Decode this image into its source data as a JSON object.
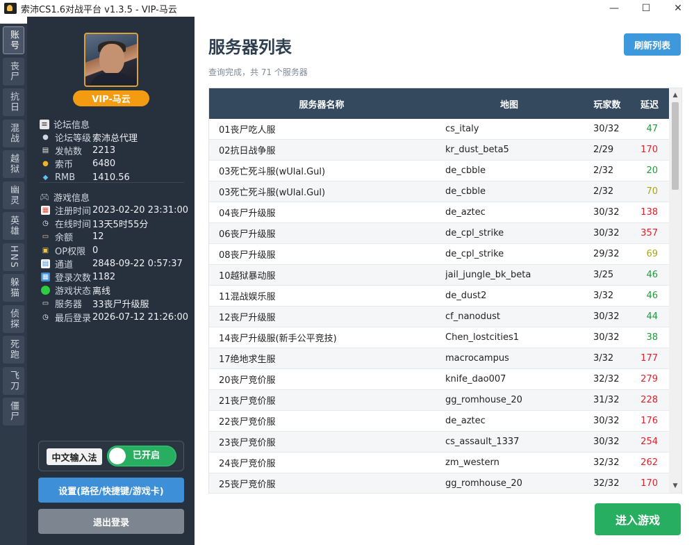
{
  "window": {
    "title": "索沛CS1.6对战平台 v1.3.5 - VIP-马云",
    "minimize": "—",
    "maximize": "☐",
    "close": "✕"
  },
  "rail": {
    "items": [
      {
        "label": "账号",
        "active": true
      },
      {
        "label": "丧尸",
        "active": false
      },
      {
        "label": "抗日",
        "active": false
      },
      {
        "label": "混战",
        "active": false
      },
      {
        "label": "越狱",
        "active": false
      },
      {
        "label": "幽灵",
        "active": false
      },
      {
        "label": "英雄",
        "active": false
      },
      {
        "label": "HNS",
        "active": false
      },
      {
        "label": "躲猫",
        "active": false
      },
      {
        "label": "侦探",
        "active": false
      },
      {
        "label": "死跑",
        "active": false
      },
      {
        "label": "飞刀",
        "active": false
      },
      {
        "label": "僵尸",
        "active": false
      }
    ]
  },
  "profile": {
    "vip_name": "VIP-马云",
    "forum_section": "论坛信息",
    "forum": [
      {
        "label": "论坛等级",
        "value": "索沛总代理",
        "icon": "user-icon"
      },
      {
        "label": "发帖数",
        "value": "2213",
        "icon": "document-icon"
      },
      {
        "label": "索币",
        "value": "6480",
        "icon": "coin-icon"
      },
      {
        "label": "RMB",
        "value": "1410.56",
        "icon": "diamond-icon"
      }
    ],
    "game_section": "游戏信息",
    "game": [
      {
        "label": "注册时间",
        "value": "2023-02-20 23:31:00",
        "icon": "calendar-icon"
      },
      {
        "label": "在线时间",
        "value": "13天5时55分",
        "icon": "stopwatch-icon"
      },
      {
        "label": "余额",
        "value": "12",
        "icon": "money-icon"
      },
      {
        "label": "OP权限",
        "value": "0",
        "icon": "lock-icon"
      },
      {
        "label": "通道",
        "value": "2848-09-22 0:57:37",
        "icon": "channel-icon"
      },
      {
        "label": "登录次数",
        "value": "1182",
        "icon": "login-icon"
      },
      {
        "label": "游戏状态",
        "value": "离线",
        "icon": "status-dot-icon"
      },
      {
        "label": "服务器",
        "value": "33丧尸升级服",
        "icon": "monitor-icon"
      },
      {
        "label": "最后登录",
        "value": "2026-07-12 21:26:00",
        "icon": "clock-icon"
      }
    ],
    "ime_label": "中文输入法",
    "ime_toggle": "已开启",
    "settings_button": "设置(路径/快捷键/游戏卡)",
    "logout_button": "退出登录"
  },
  "main": {
    "title": "服务器列表",
    "refresh_button": "刷新列表",
    "status": "查询完成，共 71 个服务器",
    "columns": [
      "服务器名称",
      "地图",
      "玩家数",
      "延迟"
    ],
    "rows": [
      {
        "name": "01丧尸吃人服",
        "map": "cs_italy",
        "players": "30/32",
        "ping": "47",
        "ping_level": "good"
      },
      {
        "name": "02抗日战争服",
        "map": "kr_dust_beta5",
        "players": "2/29",
        "ping": "170",
        "ping_level": "bad"
      },
      {
        "name": "03死亡死斗服(wUlal.Gul)",
        "map": "de_cbble",
        "players": "2/32",
        "ping": "20",
        "ping_level": "good"
      },
      {
        "name": "03死亡死斗服(wUlal.Gul)",
        "map": "de_cbble",
        "players": "2/32",
        "ping": "70",
        "ping_level": "mid"
      },
      {
        "name": "04丧尸升级服",
        "map": "de_aztec",
        "players": "30/32",
        "ping": "138",
        "ping_level": "bad"
      },
      {
        "name": "06丧尸升级服",
        "map": "de_cpl_strike",
        "players": "30/32",
        "ping": "357",
        "ping_level": "bad"
      },
      {
        "name": "08丧尸升级服",
        "map": "de_cpl_strike",
        "players": "29/32",
        "ping": "69",
        "ping_level": "mid"
      },
      {
        "name": "10越狱暴动服",
        "map": "jail_jungle_bk_beta",
        "players": "3/25",
        "ping": "46",
        "ping_level": "good"
      },
      {
        "name": "11混战娱乐服",
        "map": "de_dust2",
        "players": "3/32",
        "ping": "46",
        "ping_level": "good"
      },
      {
        "name": "12丧尸升级服",
        "map": "cf_nanodust",
        "players": "30/32",
        "ping": "44",
        "ping_level": "good"
      },
      {
        "name": "14丧尸升级服(新手公平竞技)",
        "map": "Chen_lostcities1",
        "players": "30/32",
        "ping": "38",
        "ping_level": "good"
      },
      {
        "name": "17绝地求生服",
        "map": "macrocampus",
        "players": "3/32",
        "ping": "177",
        "ping_level": "bad"
      },
      {
        "name": "20丧尸竞价服",
        "map": "knife_dao007",
        "players": "32/32",
        "ping": "279",
        "ping_level": "bad"
      },
      {
        "name": "21丧尸竞价服",
        "map": "gg_romhouse_20",
        "players": "31/32",
        "ping": "228",
        "ping_level": "bad"
      },
      {
        "name": "22丧尸竞价服",
        "map": "de_aztec",
        "players": "30/32",
        "ping": "176",
        "ping_level": "bad"
      },
      {
        "name": "23丧尸竞价服",
        "map": "cs_assault_1337",
        "players": "30/32",
        "ping": "254",
        "ping_level": "bad"
      },
      {
        "name": "24丧尸竞价服",
        "map": "zm_western",
        "players": "32/32",
        "ping": "262",
        "ping_level": "bad"
      },
      {
        "name": "25丧尸竞价服",
        "map": "gg_romhouse_20",
        "players": "32/32",
        "ping": "170",
        "ping_level": "bad"
      }
    ],
    "enter_button": "进入游戏"
  },
  "colors": {
    "rail_bg": "#2f3a48",
    "panel_bg": "#27313e",
    "vip": "#f39c12",
    "header": "#34495e",
    "primary": "#3d8fd8",
    "success": "#27ae60",
    "ping_good": "#1f9a3a",
    "ping_mid": "#a8a41a",
    "ping_bad": "#e0202a"
  }
}
